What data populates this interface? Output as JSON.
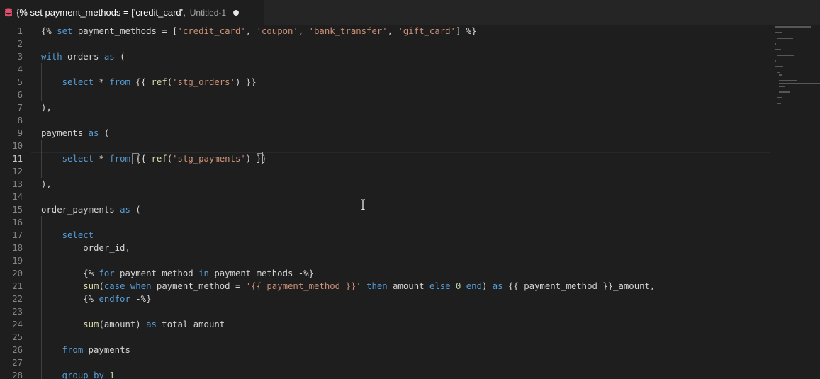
{
  "tab": {
    "title": "{% set payment_methods = ['credit_card',",
    "description": "Untitled-1",
    "icon": "database-icon",
    "modified": true
  },
  "editor": {
    "active_line": 11,
    "line_numbers": [
      "1",
      "2",
      "3",
      "4",
      "5",
      "6",
      "7",
      "8",
      "9",
      "10",
      "11",
      "12",
      "13",
      "14",
      "15",
      "16",
      "17",
      "18",
      "19",
      "20",
      "21",
      "22",
      "23",
      "24",
      "25",
      "26",
      "27",
      "28"
    ],
    "lines": [
      "{% set payment_methods = ['credit_card', 'coupon', 'bank_transfer', 'gift_card'] %}",
      "",
      "with orders as (",
      "",
      "    select * from {{ ref('stg_orders') }}",
      "",
      "),",
      "",
      "payments as (",
      "",
      "    select * from {{ ref('stg_payments') }}",
      "",
      "),",
      "",
      "order_payments as (",
      "",
      "    select",
      "        order_id,",
      "",
      "        {% for payment_method in payment_methods -%}",
      "        sum(case when payment_method = '{{ payment_method }}' then amount else 0 end) as {{ payment_method }}_amount,",
      "        {% endfor -%}",
      "",
      "        sum(amount) as total_amount",
      "",
      "    from payments",
      "",
      "    group by 1"
    ]
  },
  "colors": {
    "keyword": "#569cd6",
    "string": "#ce9178",
    "function": "#dcdcaa",
    "number": "#b5cea8",
    "text": "#d4d4d4",
    "tab_icon": "#e0506e"
  }
}
